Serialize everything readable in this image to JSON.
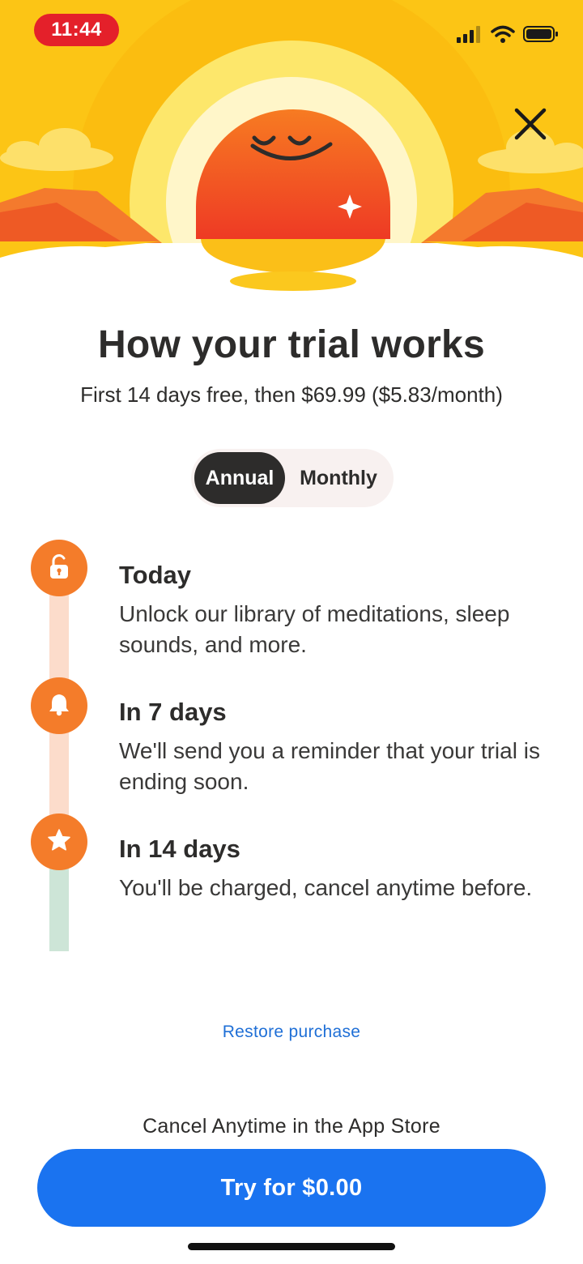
{
  "status_bar": {
    "time": "11:44"
  },
  "icons": {
    "signal": "cellular-signal-icon",
    "wifi": "wifi-icon",
    "battery": "battery-icon",
    "close": "close-icon",
    "lock": "unlock-icon",
    "bell": "bell-icon",
    "star": "star-icon"
  },
  "colors": {
    "brand_orange": "#f47c2a",
    "sun_yellow": "#fcc515",
    "cta_blue": "#1a73f0",
    "link_blue": "#1f6fd6",
    "time_pill_red": "#e4202a"
  },
  "header": {
    "title": "How your trial works",
    "subtitle": "First 14 days free, then $69.99 ($5.83/month)"
  },
  "plan_toggle": {
    "options": [
      "Annual",
      "Monthly"
    ],
    "selected": "Annual"
  },
  "timeline": [
    {
      "title": "Today",
      "description": "Unlock our library of meditations, sleep sounds, and more."
    },
    {
      "title": "In 7 days",
      "description": "We'll send you a reminder that your trial is ending soon."
    },
    {
      "title": "In 14 days",
      "description": "You'll be charged, cancel anytime before."
    }
  ],
  "footer": {
    "restore_label": "Restore purchase",
    "cancel_note": "Cancel Anytime in the App Store",
    "cta_label": "Try for $0.00"
  }
}
